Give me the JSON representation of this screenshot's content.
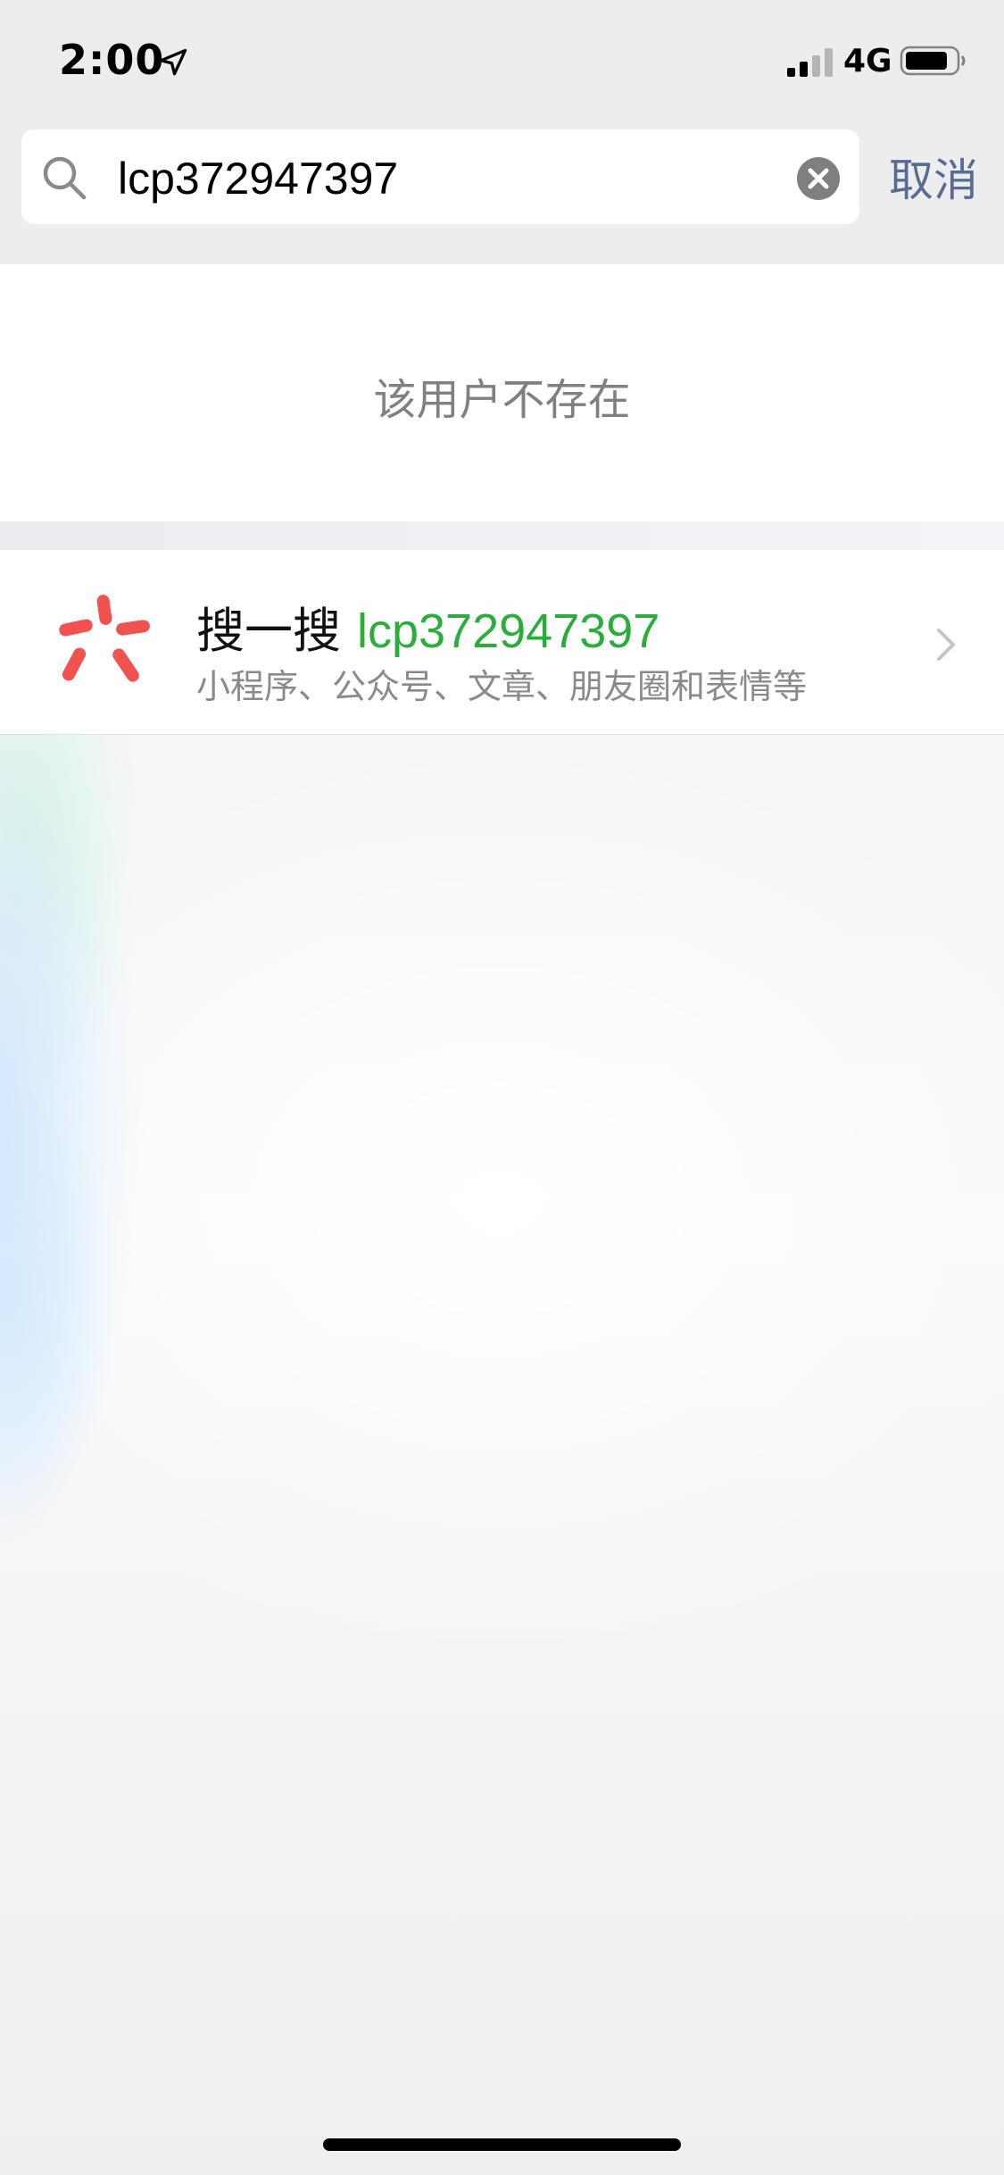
{
  "status_bar": {
    "time": "2:00",
    "network": "4G",
    "icons": [
      "location-arrow-icon",
      "signal-icon",
      "battery-icon"
    ]
  },
  "search": {
    "query": "lcp372947397",
    "cancel_label": "取消",
    "icons": [
      "search-icon",
      "clear-icon"
    ]
  },
  "result": {
    "not_found_text": "该用户不存在"
  },
  "sou_yi_sou": {
    "prefix": "搜一搜",
    "query": "lcp372947397",
    "subtitle": "小程序、公众号、文章、朋友圈和表情等",
    "logo_icon": "sou-yi-sou-logo-icon",
    "chevron_icon": "chevron-right-icon"
  },
  "colors": {
    "accent_link": "#576b95",
    "highlight_green": "#2aae3a",
    "logo_red": "#f0524f",
    "secondary_text": "#808080"
  }
}
